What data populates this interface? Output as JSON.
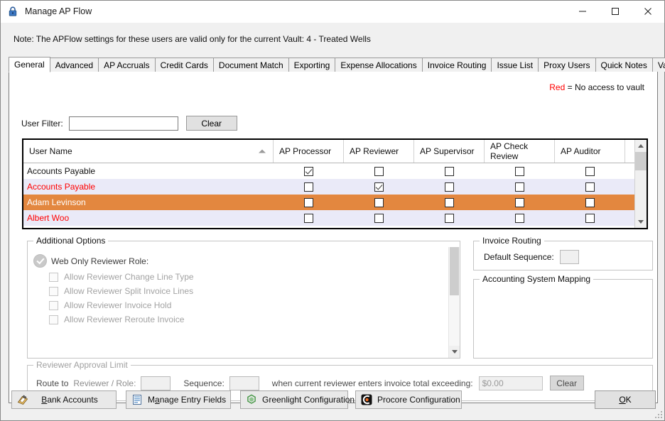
{
  "window": {
    "title": "Manage AP Flow",
    "icon": "lock-icon",
    "minimize_label": "–",
    "maximize_label": "□",
    "close_label": "✕"
  },
  "note": "Note:  The APFlow settings for these users are valid only for the current Vault: 4 - Treated Wells",
  "tabs": [
    {
      "label": "General",
      "active": true
    },
    {
      "label": "Advanced",
      "active": false
    },
    {
      "label": "AP Accruals",
      "active": false
    },
    {
      "label": "Credit Cards",
      "active": false
    },
    {
      "label": "Document Match",
      "active": false
    },
    {
      "label": "Exporting",
      "active": false
    },
    {
      "label": "Expense Allocations",
      "active": false
    },
    {
      "label": "Invoice Routing",
      "active": false
    },
    {
      "label": "Issue List",
      "active": false
    },
    {
      "label": "Proxy Users",
      "active": false
    },
    {
      "label": "Quick Notes",
      "active": false
    },
    {
      "label": "Validation",
      "active": false
    }
  ],
  "legend": {
    "red_word": "Red",
    "description": "= No access to vault"
  },
  "filter": {
    "label": "User Filter:",
    "value": "",
    "placeholder": "",
    "clear_label": "Clear"
  },
  "grid": {
    "columns": [
      "User Name",
      "AP Processor",
      "AP Reviewer",
      "AP Supervisor",
      "AP Check Review",
      "AP Auditor"
    ],
    "sort_column": "User Name",
    "sort_direction": "ascending",
    "rows": [
      {
        "user_name": "Accounts Payable",
        "style": "normal",
        "ap_processor": true,
        "ap_reviewer": false,
        "ap_supervisor": false,
        "ap_check_review": false,
        "ap_auditor": false
      },
      {
        "user_name": "Accounts Payable",
        "style": "alt-red",
        "ap_processor": false,
        "ap_reviewer": true,
        "ap_supervisor": false,
        "ap_check_review": false,
        "ap_auditor": false
      },
      {
        "user_name": "Adam Levinson",
        "style": "selected",
        "ap_processor": false,
        "ap_reviewer": false,
        "ap_supervisor": false,
        "ap_check_review": false,
        "ap_auditor": false
      },
      {
        "user_name": "Albert Woo",
        "style": "alt-red",
        "ap_processor": false,
        "ap_reviewer": false,
        "ap_supervisor": false,
        "ap_check_review": false,
        "ap_auditor": false
      }
    ]
  },
  "additional_options": {
    "title": "Additional Options",
    "web_only_reviewer_role": {
      "label": "Web Only Reviewer Role:",
      "checked": true,
      "enabled": false
    },
    "sub_options": [
      {
        "label": "Allow Reviewer Change Line Type",
        "checked": false
      },
      {
        "label": "Allow Reviewer Split Invoice Lines",
        "checked": false
      },
      {
        "label": "Allow Reviewer Invoice Hold",
        "checked": false
      },
      {
        "label": "Allow Reviewer Reroute Invoice",
        "checked": false
      }
    ]
  },
  "invoice_routing": {
    "title": "Invoice Routing",
    "default_sequence_label": "Default Sequence:",
    "default_sequence_value": ""
  },
  "accounting_system_mapping": {
    "title": "Accounting System Mapping"
  },
  "reviewer_approval_limit": {
    "title": "Reviewer Approval Limit",
    "route_to_label": "Route to",
    "reviewer_role_label": "Reviewer / Role:",
    "reviewer_role_value": "",
    "sequence_label": "Sequence:",
    "sequence_value": "",
    "condition_text": "when current reviewer enters invoice total exceeding:",
    "amount_value": "$0.00",
    "clear_label": "Clear"
  },
  "bottom_buttons": {
    "bank_accounts": "Bank Accounts",
    "manage_entry_fields": "Manage Entry Fields",
    "greenlight_configuration": "Greenlight Configuration",
    "procore_configuration": "Procore Configuration",
    "ok": "OK"
  },
  "colors": {
    "selected_row": "#e3873f",
    "alt_row": "#eaeaf8",
    "no_access_text": "#ff0000",
    "greenlight_green": "#4c9a4c",
    "procore_orange": "#f36c21"
  }
}
